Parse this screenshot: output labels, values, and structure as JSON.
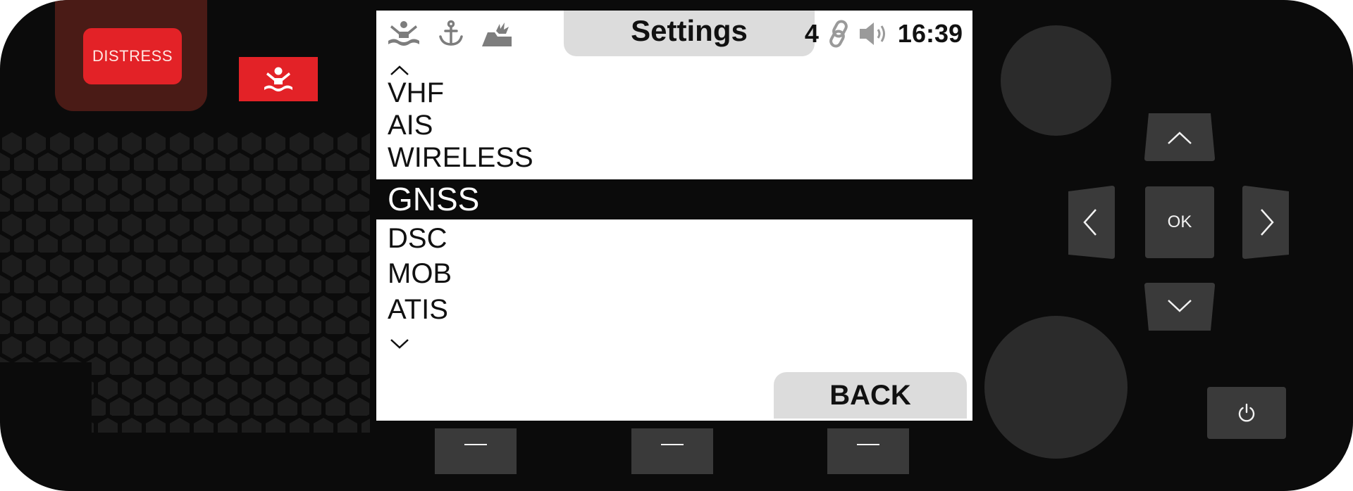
{
  "device": {
    "distress_label": "DISTRESS",
    "ok_label": "OK",
    "icons": {
      "mob": "man-overboard-icon",
      "up": "chevron-up-icon",
      "down": "chevron-down-icon",
      "left": "chevron-left-icon",
      "right": "chevron-right-icon",
      "power": "power-icon"
    }
  },
  "screen": {
    "title": "Settings",
    "status": {
      "icons": [
        "man-overboard-icon",
        "anchor-icon",
        "ship-alert-icon",
        "link-icon",
        "speaker-icon"
      ],
      "count": "4",
      "time": "16:39"
    },
    "menu": {
      "items": [
        "VHF",
        "AIS",
        "WIRELESS",
        "GNSS",
        "DSC",
        "MOB",
        "ATIS"
      ],
      "selected": "GNSS"
    },
    "back_label": "BACK"
  },
  "softkeys": [
    {
      "icon": "dash-icon"
    },
    {
      "icon": "dash-icon"
    },
    {
      "icon": "dash-icon"
    }
  ],
  "colors": {
    "body": "#0b0b0b",
    "distress": "#e32227",
    "distress_panel": "#4a1b16",
    "screen": "#ffffff",
    "selection": "#0b0b0b",
    "button": "#3a3a3a",
    "tab": "#dcdcdc",
    "knob": "#2b2b2b"
  }
}
